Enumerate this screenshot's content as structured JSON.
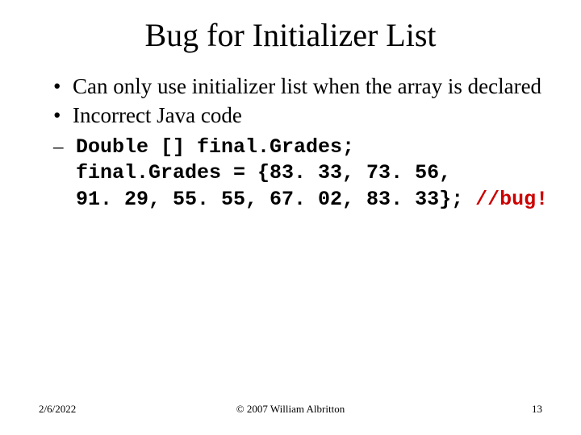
{
  "title": "Bug for Initializer List",
  "bullets": [
    "Can only use initializer list when the array is declared",
    "Incorrect Java code"
  ],
  "code": {
    "line1": "Double [] final.Grades;",
    "line2": "final.Grades = {83. 33, 73. 56,",
    "line3": "91. 29, 55. 55, 67. 02, 83. 33}; ",
    "comment": "//bug!"
  },
  "footer": {
    "date": "2/6/2022",
    "copyright": "© 2007 William Albritton",
    "page": "13"
  }
}
